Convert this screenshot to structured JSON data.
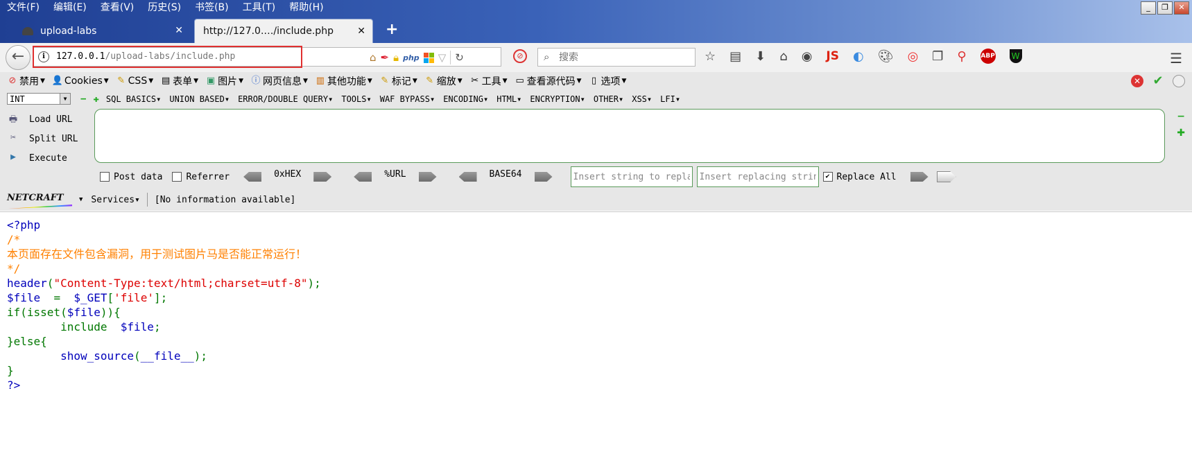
{
  "menubar": [
    "文件(F)",
    "编辑(E)",
    "查看(V)",
    "历史(S)",
    "书签(B)",
    "工具(T)",
    "帮助(H)"
  ],
  "window_controls": {
    "minimize": "_",
    "restore": "❐",
    "close": "✕"
  },
  "tabs": [
    {
      "title": "upload-labs",
      "active": false,
      "close": "✕"
    },
    {
      "title": "http://127.0.…/include.php",
      "active": true,
      "close": "✕"
    }
  ],
  "new_tab": "+",
  "urlbar": {
    "host": "127.0.0.1",
    "path": "/upload-labs/include.php",
    "info_icon": "i"
  },
  "search": {
    "placeholder": "搜索"
  },
  "devbar": {
    "items": [
      {
        "label": "禁用",
        "icon": "⊘"
      },
      {
        "label": "Cookies",
        "icon": "👤"
      },
      {
        "label": "CSS",
        "icon": "✎"
      },
      {
        "label": "表单",
        "icon": "▤"
      },
      {
        "label": "图片",
        "icon": "▣"
      },
      {
        "label": "网页信息",
        "icon": "ⓘ"
      },
      {
        "label": "其他功能",
        "icon": "▥"
      },
      {
        "label": "标记",
        "icon": "✎"
      },
      {
        "label": "缩放",
        "icon": "✎"
      },
      {
        "label": "工具",
        "icon": "✂"
      },
      {
        "label": "查看源代码",
        "icon": "▭"
      },
      {
        "label": "选项",
        "icon": "▯"
      }
    ]
  },
  "hackbar": {
    "select_value": "INT",
    "menu": [
      "SQL BASICS",
      "UNION BASED",
      "ERROR/DOUBLE QUERY",
      "TOOLS",
      "WAF BYPASS",
      "ENCODING",
      "HTML",
      "ENCRYPTION",
      "OTHER",
      "XSS",
      "LFI"
    ],
    "load_url": "Load URL",
    "split_url": "Split URL",
    "execute": "Execute",
    "post_data": "Post data",
    "referrer": "Referrer",
    "hex": "0xHEX",
    "url": "%URL",
    "base64": "BASE64",
    "insert_placeholder": "Insert string to replace",
    "replacing_placeholder": "Insert replacing string",
    "replace_all": "Replace All",
    "replace_all_checked": true
  },
  "netcraft": {
    "logo": "NETCRAFT",
    "services": "Services",
    "info": "[No information available]"
  },
  "code": {
    "open_tag": "<?php",
    "comment_open": "/*",
    "comment_text": "本页面存在文件包含漏洞，用于测试图片马是否能正常运行！",
    "comment_close": "*/",
    "l_header_fn": "header",
    "l_header_str": "\"Content-Type:text/html;charset=utf-8\"",
    "l_file_var": "$file",
    "l_file_eq": "  =  ",
    "l_file_get": "$_GET",
    "l_file_key": "'file'",
    "l_if": "if(isset(",
    "l_if_var": "$file",
    "l_if_end": ")){",
    "l_include": "        include  ",
    "l_include_var": "$file",
    "l_else": "}else{",
    "l_show": "show_source",
    "l_show_arg": "__file__",
    "l_close_brace": "}",
    "close_tag": "?>"
  }
}
